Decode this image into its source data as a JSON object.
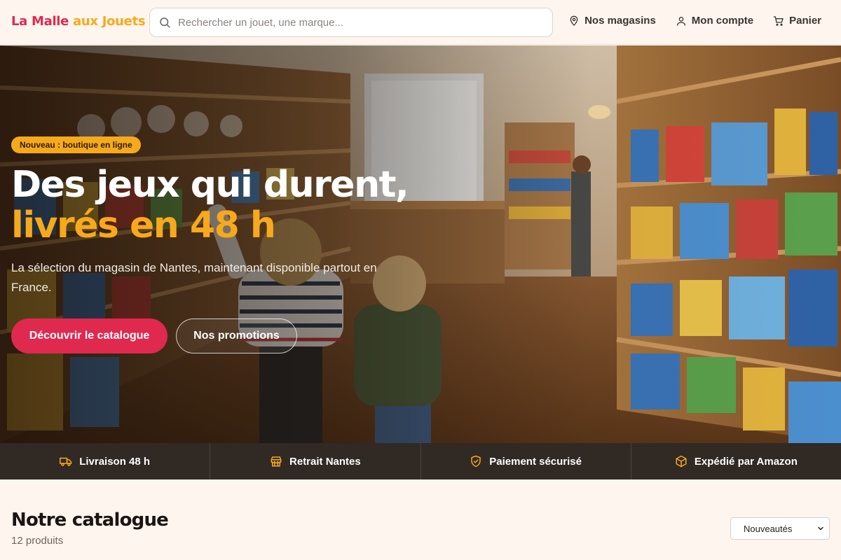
{
  "header": {
    "logo_part1": "La Malle",
    "logo_part2": "aux Jouets",
    "search_placeholder": "Rechercher un jouet, une marque...",
    "nav": [
      {
        "label": "Nos magasins",
        "icon": "map-pin-icon"
      },
      {
        "label": "Mon compte",
        "icon": "user-icon"
      },
      {
        "label": "Panier",
        "icon": "cart-icon"
      }
    ]
  },
  "hero": {
    "badge": "Nouveau : boutique en ligne",
    "title_line1": "Des jeux qui durent,",
    "title_line2": "livrés en 48 h",
    "subtitle": "La sélection du magasin de Nantes, maintenant disponible partout en France.",
    "primary_cta": "Découvrir le catalogue",
    "secondary_cta": "Nos promotions"
  },
  "features": [
    {
      "label": "Livraison 48 h",
      "icon": "truck-icon"
    },
    {
      "label": "Retrait Nantes",
      "icon": "store-icon"
    },
    {
      "label": "Paiement sécurisé",
      "icon": "shield-check-icon"
    },
    {
      "label": "Expédié par Amazon",
      "icon": "package-icon"
    }
  ],
  "catalog": {
    "title": "Notre catalogue",
    "count": "12 produits",
    "sort_selected": "Nouveautés"
  },
  "colors": {
    "brand_red": "#e0294f",
    "brand_yellow": "#f7a91c",
    "page_bg": "#fdf5ee",
    "feature_bar_bg": "#261e18"
  }
}
